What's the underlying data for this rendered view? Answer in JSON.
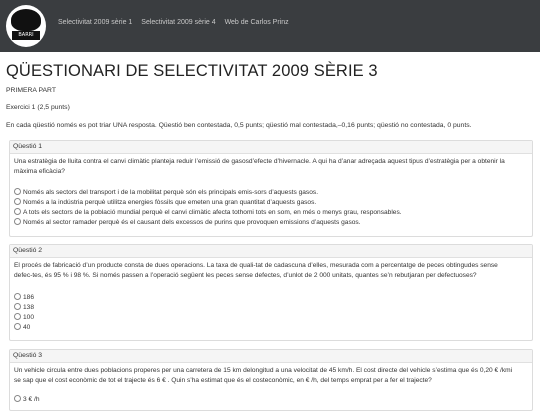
{
  "header": {
    "logo_text": "BARRI TOTS",
    "nav": [
      "Selectivitat 2009 sèrie 1",
      "Selectivitat 2009 sèrie 4",
      "Web de Carlos Prinz"
    ]
  },
  "page": {
    "title": "QÜESTIONARI DE SELECTIVITAT 2009 SÈRIE 3",
    "part": "PRIMERA PART",
    "exercise": "Exercici 1 (2,5 punts)",
    "instructions": "En cada qüestió només es pot triar UNA resposta. Qüestió ben contestada, 0,5 punts; qüestió mal contestada,–0,16 punts; qüestió no contestada, 0 punts."
  },
  "questions": [
    {
      "label": "Qüestió 1",
      "text": [
        "Una estratègia de lluita contra el canvi climàtic planteja reduir l’emissió de gasosd’efecte d’hivernacle. A qui ha d’anar adreçada aquest tipus d’estratègia per a obtenir la",
        "màxima eficàcia?"
      ],
      "options": [
        "Només als sectors del transport i de la mobilitat perquè són els principals emis-sors d’aquests gasos.",
        "Només a la indústria perquè utilitza energies fòssils que emeten una gran quantitat d’aquests gasos.",
        "A tots els sectors de la població mundial perquè el canvi climàtic afecta tothomi tots en som, en més o menys grau, responsables.",
        "Només al sector ramader perquè és el causant dels excessos de purins que provoquen emissions d’aquests gasos."
      ]
    },
    {
      "label": "Qüestió 2",
      "text": [
        "El procés de fabricació d’un producte consta de dues operacions. La taxa de quali-tat de cadascuna d’elles, mesurada com a percentatge de peces obtingudes sense",
        "defec-tes, és 95 % i 98 %. Si només passen a l’operació següent les peces sense defectes, d’unlot de 2 000 unitats, quantes se’n rebutjaran per defectuoses?"
      ],
      "options": [
        "186",
        "138",
        "100",
        "40"
      ]
    },
    {
      "label": "Qüestió 3",
      "text": [
        "Un vehicle circula entre dues poblacions properes per una carretera de 15 km delongitud a una velocitat de 45 km/h. El cost directe del vehicle s’estima que és 0,20 € /kmi",
        "se sap que el cost econòmic de tot el trajecte és 6 € . Quin s’ha estimat que és el costeconòmic, en € /h, del temps emprat per a fer el trajecte?"
      ],
      "options": [
        "3 € /h"
      ]
    }
  ]
}
